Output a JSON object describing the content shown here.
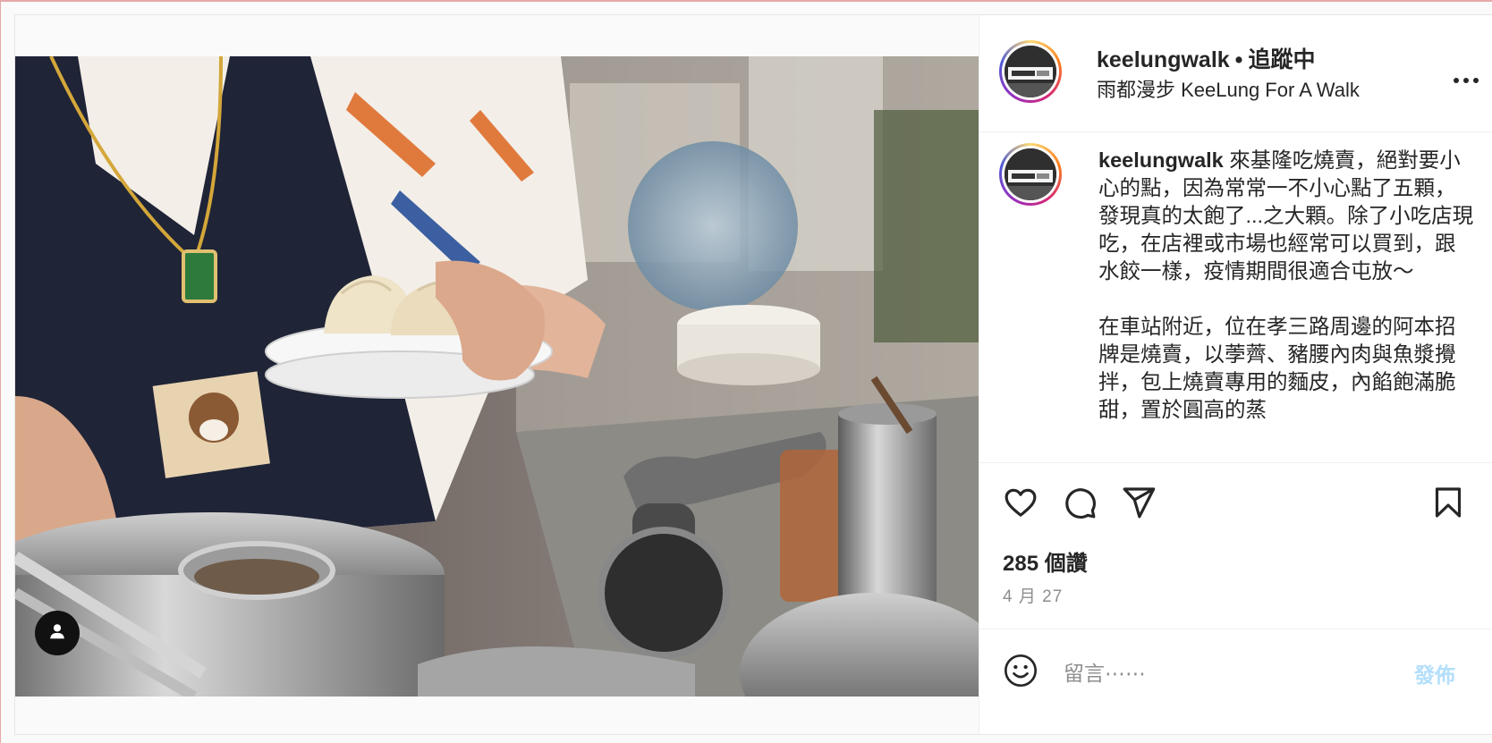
{
  "post": {
    "username": "keelungwalk",
    "separator": "•",
    "follow_status": "追蹤中",
    "profile_name": "雨都漫步 KeeLung For A Walk",
    "caption": {
      "username": "keelungwalk",
      "text": " 來基隆吃燒賣，絕對要小心的點，因為常常一不小心點了五顆，發現真的太飽了...之大顆。除了小吃店現吃，在店裡或市場也經常可以買到，跟水餃一樣，疫情期間很適合屯放～\n\n在車站附近，位在孝三路周邊的阿本招牌是燒賣，以荸薺、豬腰內肉與魚漿攪拌，包上燒賣專用的麵皮，內餡飽滿脆甜，置於圓高的蒸"
    },
    "likes": "285 個讚",
    "date": "4 月 27"
  },
  "comment": {
    "placeholder": "留言⋯⋯",
    "post_label": "發佈"
  },
  "icons": {
    "more": "more-horizontal-icon",
    "like": "heart-icon",
    "comment": "comment-bubble-icon",
    "share": "paper-plane-icon",
    "save": "bookmark-icon",
    "emoji": "smiley-icon",
    "tagged_user": "user-tag-icon"
  },
  "colors": {
    "text": "#262626",
    "secondary": "#8e8e8e",
    "post_button_disabled": "#b2dffc",
    "border": "#efefef"
  }
}
